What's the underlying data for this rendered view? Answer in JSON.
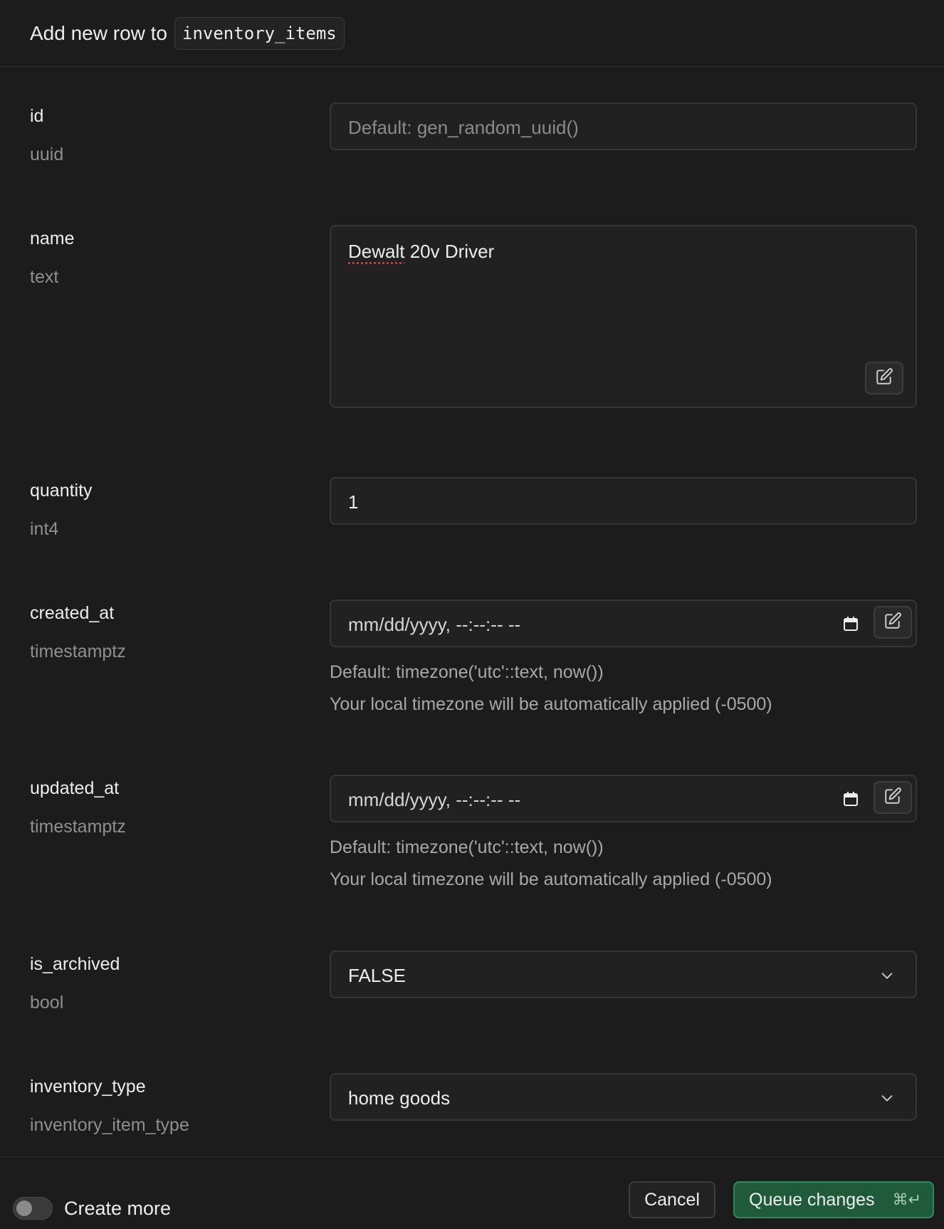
{
  "header": {
    "title": "Add new row to",
    "table_name": "inventory_items"
  },
  "fields": [
    {
      "name": "id",
      "type": "uuid",
      "placeholder": "Default: gen_random_uuid()"
    },
    {
      "name": "name",
      "type": "text",
      "value": "Dewalt 20v Driver",
      "value_first_word": "Dewalt",
      "value_rest": " 20v Driver"
    },
    {
      "name": "quantity",
      "type": "int4",
      "value": "1"
    },
    {
      "name": "created_at",
      "type": "timestamptz",
      "placeholder": "mm/dd/yyyy, --:--:-- --",
      "default_note": "Default: timezone('utc'::text, now())",
      "timezone_note": "Your local timezone will be automatically applied (-0500)"
    },
    {
      "name": "updated_at",
      "type": "timestamptz",
      "placeholder": "mm/dd/yyyy, --:--:-- --",
      "default_note": "Default: timezone('utc'::text, now())",
      "timezone_note": "Your local timezone will be automatically applied (-0500)"
    },
    {
      "name": "is_archived",
      "type": "bool",
      "value": "FALSE"
    },
    {
      "name": "inventory_type",
      "type": "inventory_item_type",
      "value": "home goods"
    }
  ],
  "icons": {
    "expand_editor": "edit-square-icon",
    "calendar": "calendar-icon",
    "dropdown": "chevron-down-icon"
  },
  "footer": {
    "create_more_label": "Create more",
    "create_more_on": false,
    "cancel_label": "Cancel",
    "queue_label": "Queue changes",
    "queue_shortcut": "⌘↵"
  },
  "colors": {
    "background": "#1c1c1c",
    "input_background": "#212121",
    "accent_green": "#1f5a3b",
    "accent_green_border": "#2f8a58"
  }
}
